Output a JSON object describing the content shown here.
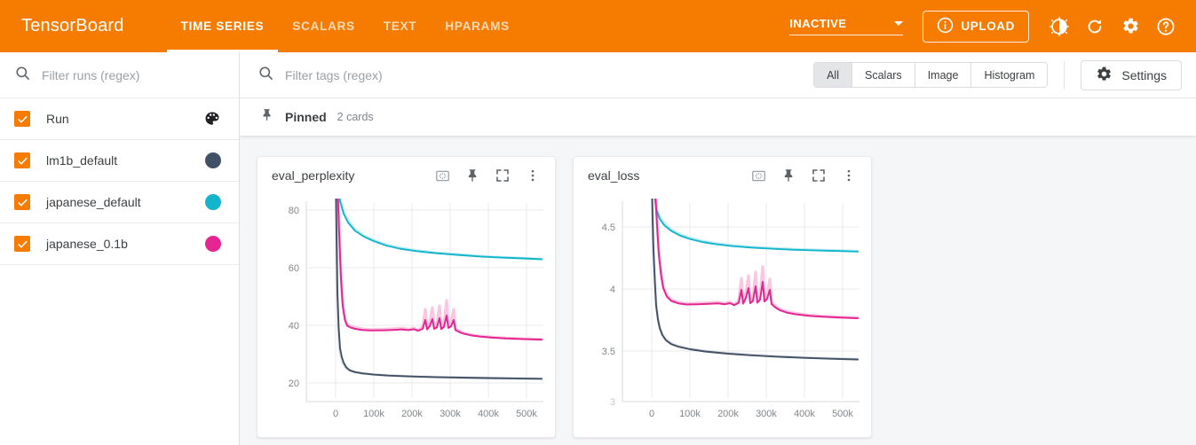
{
  "app": {
    "brand": "TensorBoard",
    "tabs": [
      {
        "label": "TIME SERIES",
        "active": true
      },
      {
        "label": "SCALARS",
        "active": false
      },
      {
        "label": "TEXT",
        "active": false
      },
      {
        "label": "HPARAMS",
        "active": false
      }
    ],
    "reload_state": "INACTIVE",
    "upload_label": "UPLOAD",
    "icons": [
      "info-icon",
      "brightness-icon",
      "refresh-icon",
      "gear-icon",
      "help-icon"
    ],
    "accent_color": "#f57c00"
  },
  "sidebar": {
    "search_placeholder": "Filter runs (regex)",
    "search_value": "",
    "runs": [
      {
        "label": "Run",
        "checked": true,
        "color": null,
        "swatch": "palette-icon"
      },
      {
        "label": "lm1b_default",
        "checked": true,
        "color": "#425066",
        "swatch": "dot"
      },
      {
        "label": "japanese_default",
        "checked": true,
        "color": "#12b5cb",
        "swatch": "dot"
      },
      {
        "label": "japanese_0.1b",
        "checked": true,
        "color": "#e52592",
        "swatch": "dot"
      }
    ]
  },
  "toolbar": {
    "tag_search_placeholder": "Filter tags (regex)",
    "tag_search_value": "",
    "filters": [
      {
        "label": "All",
        "selected": true
      },
      {
        "label": "Scalars",
        "selected": false
      },
      {
        "label": "Image",
        "selected": false
      },
      {
        "label": "Histogram",
        "selected": false
      }
    ],
    "settings_label": "Settings"
  },
  "pinned": {
    "title": "Pinned",
    "count_label": "2 cards"
  },
  "cards": [
    {
      "title": "eval_perplexity",
      "actions": [
        "fit-domain-icon",
        "pin-icon",
        "fullscreen-icon",
        "overflow-menu-icon"
      ]
    },
    {
      "title": "eval_loss",
      "actions": [
        "fit-domain-icon",
        "pin-icon",
        "fullscreen-icon",
        "overflow-menu-icon"
      ]
    }
  ],
  "chart_data": [
    {
      "type": "line",
      "title": "eval_perplexity",
      "xlabel": "",
      "ylabel": "",
      "xlim": [
        -30000,
        530000
      ],
      "ylim": [
        14,
        88
      ],
      "xticks": [
        0,
        100000,
        200000,
        300000,
        400000,
        500000
      ],
      "xticklabels": [
        "0",
        "100k",
        "200k",
        "300k",
        "400k",
        "500k"
      ],
      "yticks": [
        20,
        40,
        60,
        80
      ],
      "yticklabels": [
        "20",
        "40",
        "60",
        "80"
      ],
      "grid": true,
      "legend": "none",
      "series": [
        {
          "name": "lm1b_default",
          "color": "#425066",
          "x": [
            0,
            2000,
            5000,
            9000,
            14000,
            20000,
            30000,
            45000,
            65000,
            90000,
            120000,
            160000,
            200000,
            250000,
            300000,
            350000,
            400000,
            450000,
            500000
          ],
          "values": [
            95,
            82,
            58,
            40,
            32,
            29,
            27,
            25.6,
            24.8,
            24.2,
            23.8,
            23.4,
            23.2,
            23.0,
            22.8,
            22.7,
            22.6,
            22.5,
            22.4
          ]
        },
        {
          "name": "japanese_default",
          "color": "#12b5cb",
          "x": [
            0,
            5000,
            12000,
            20000,
            30000,
            45000,
            65000,
            90000,
            120000,
            160000,
            200000,
            250000,
            300000,
            350000,
            400000,
            450000,
            500000
          ],
          "values": [
            110,
            95,
            86,
            81.5,
            78,
            75,
            73,
            71.5,
            70.3,
            69.2,
            68.5,
            67.8,
            67.3,
            66.9,
            66.6,
            66.3,
            66.0
          ]
        },
        {
          "name": "japanese_0.1b",
          "color": "#e52592",
          "x": [
            0,
            10000,
            20000,
            30000,
            40000,
            48000,
            55000,
            65000,
            80000,
            100000,
            130000,
            160000,
            190000,
            210000,
            230000,
            238000,
            245000,
            255000,
            262000,
            270000,
            278000,
            285000,
            292000,
            300000,
            310000,
            330000,
            360000,
            400000,
            450000,
            500000
          ],
          "values": [
            160,
            150,
            140,
            120,
            95,
            62,
            45,
            41,
            39.5,
            38.8,
            38.6,
            39.0,
            39.2,
            39.0,
            40.5,
            44.0,
            40.0,
            39.5,
            43.0,
            40.0,
            43.8,
            41.5,
            43.0,
            41.0,
            39.0,
            37.8,
            37.0,
            36.4,
            35.8,
            35.4
          ]
        }
      ],
      "unsmoothed_series": [
        {
          "name": "lm1b_default",
          "color": "#b8bec9"
        },
        {
          "name": "japanese_default",
          "color": "#9fe0e9"
        },
        {
          "name": "japanese_0.1b",
          "color": "#f8b9d8"
        }
      ]
    },
    {
      "type": "line",
      "title": "eval_loss",
      "xlabel": "",
      "ylabel": "",
      "xlim": [
        -30000,
        530000
      ],
      "ylim": [
        2.98,
        4.68
      ],
      "xticks": [
        0,
        100000,
        200000,
        300000,
        400000,
        500000
      ],
      "xticklabels": [
        "0",
        "100k",
        "200k",
        "300k",
        "400k",
        "500k"
      ],
      "yticks": [
        3.5,
        4,
        4.5
      ],
      "yticklabels": [
        "3.5",
        "4",
        "4.5"
      ],
      "grid": true,
      "legend": "none",
      "series": [
        {
          "name": "lm1b_default",
          "color": "#425066",
          "x": [
            0,
            2000,
            5000,
            9000,
            14000,
            20000,
            30000,
            45000,
            65000,
            90000,
            120000,
            160000,
            200000,
            250000,
            300000,
            350000,
            400000,
            450000,
            500000
          ],
          "values": [
            4.62,
            4.45,
            4.08,
            3.72,
            3.5,
            3.4,
            3.33,
            3.27,
            3.24,
            3.22,
            3.2,
            3.18,
            3.16,
            3.15,
            3.14,
            3.13,
            3.12,
            3.12,
            3.11
          ]
        },
        {
          "name": "japanese_default",
          "color": "#12b5cb",
          "x": [
            0,
            5000,
            12000,
            20000,
            30000,
            45000,
            65000,
            90000,
            120000,
            160000,
            200000,
            250000,
            300000,
            350000,
            400000,
            450000,
            500000
          ],
          "values": [
            4.72,
            4.56,
            4.46,
            4.4,
            4.36,
            4.32,
            4.29,
            4.27,
            4.25,
            4.24,
            4.23,
            4.22,
            4.21,
            4.205,
            4.2,
            4.195,
            4.19
          ]
        },
        {
          "name": "japanese_0.1b",
          "color": "#e52592",
          "x": [
            0,
            10000,
            20000,
            30000,
            40000,
            48000,
            55000,
            65000,
            80000,
            100000,
            130000,
            160000,
            190000,
            210000,
            230000,
            238000,
            245000,
            255000,
            262000,
            270000,
            278000,
            285000,
            292000,
            300000,
            310000,
            330000,
            360000,
            400000,
            450000,
            500000
          ],
          "values": [
            5.08,
            5.01,
            4.94,
            4.79,
            4.55,
            4.13,
            3.81,
            3.71,
            3.68,
            3.66,
            3.65,
            3.66,
            3.67,
            3.66,
            3.7,
            3.78,
            3.69,
            3.68,
            3.76,
            3.69,
            3.78,
            3.72,
            3.76,
            3.71,
            3.66,
            3.63,
            3.61,
            3.59,
            3.57,
            3.56
          ]
        }
      ],
      "unsmoothed_series": [
        {
          "name": "lm1b_default",
          "color": "#b8bec9"
        },
        {
          "name": "japanese_default",
          "color": "#9fe0e9"
        },
        {
          "name": "japanese_0.1b",
          "color": "#f8b9d8"
        }
      ]
    }
  ]
}
